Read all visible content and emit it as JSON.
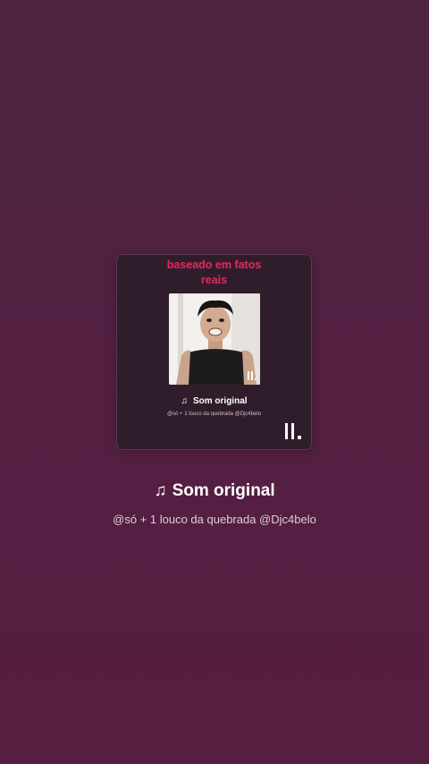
{
  "overlay_caption": "baseado em fatos\nreais",
  "card": {
    "title": "Som original",
    "subtitle": "@só + 1 louco da quebrada @Djc4belo",
    "note_icon": "music-note-icon",
    "logo_icon": "tiktok-bars-logo-icon"
  },
  "sound": {
    "title": "Som original",
    "subtitle": "@só + 1 louco da quebrada @Djc4belo",
    "note_icon": "music-note-icon"
  },
  "colors": {
    "background_top": "#4d2541",
    "background_bottom": "#561e41",
    "caption_accent": "#e8285d",
    "card_background": "#301d2b"
  }
}
